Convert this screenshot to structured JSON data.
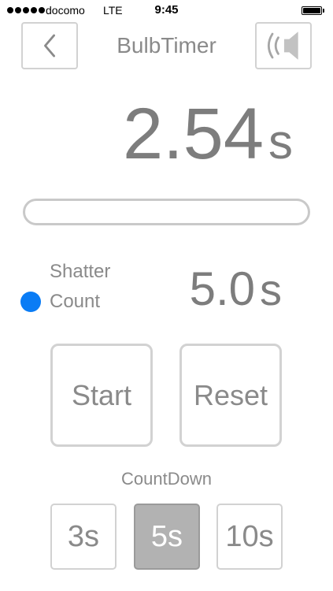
{
  "status_bar": {
    "carrier": "docomo",
    "network": "LTE",
    "time": "9:45",
    "signal_dots": 5,
    "battery_level": 1.0
  },
  "nav": {
    "title": "BulbTimer",
    "back_icon": "chevron-left-icon",
    "sound_icon": "speaker-icon"
  },
  "timer": {
    "elapsed_value": "2.54",
    "elapsed_unit": "s",
    "progress": 0
  },
  "shutter": {
    "label_line1": "Shatter",
    "label_line2": "Count",
    "value": "5.0",
    "unit": "s",
    "indicator_color": "#0a7cf5"
  },
  "buttons": {
    "start": "Start",
    "reset": "Reset"
  },
  "countdown": {
    "label": "CountDown",
    "options": [
      "3s",
      "5s",
      "10s"
    ],
    "selected": "5s"
  },
  "colors": {
    "text": "#8a8a8a",
    "border": "#d2d2d2",
    "selected_bg": "#b2b2b2",
    "accent": "#0a7cf5"
  }
}
